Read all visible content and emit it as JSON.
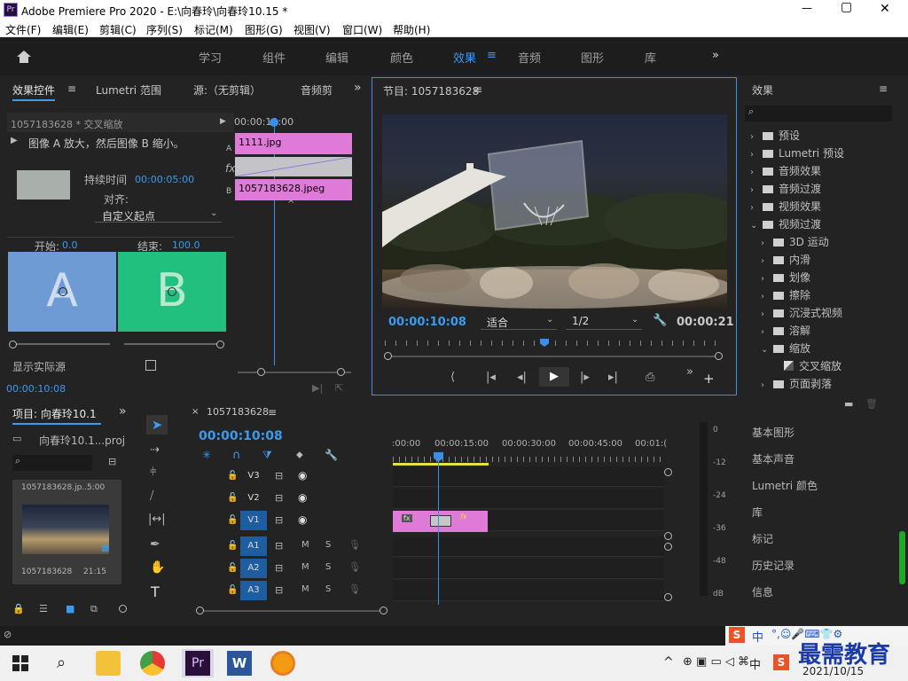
{
  "title": "Adobe Premiere Pro 2020 - E:\\向春玲\\向春玲10.15 *",
  "app_icon_label": "Pr",
  "window_controls": {
    "min": "—",
    "max": "▢",
    "close": "✕"
  },
  "menu": [
    "文件(F)",
    "编辑(E)",
    "剪辑(C)",
    "序列(S)",
    "标记(M)",
    "图形(G)",
    "视图(V)",
    "窗口(W)",
    "帮助(H)"
  ],
  "workspaces": [
    "学习",
    "组件",
    "编辑",
    "颜色",
    "效果",
    "音频",
    "图形",
    "库"
  ],
  "active_workspace": "效果",
  "effect_controls": {
    "tabs": [
      "效果控件",
      "Lumetri 范围",
      "源:（无剪辑）",
      "音频剪"
    ],
    "clip_name": "1057183628 * 交叉缩放",
    "description": "图像 A 放大，然后图像 B 缩小。",
    "duration_label": "持续时间",
    "duration_value": "00:00:05:00",
    "align_label": "对齐:",
    "align_value": "自定义起点",
    "start_label": "开始:",
    "start_value": "0.0",
    "end_label": "结束:",
    "end_value": "100.0",
    "a": "A",
    "b": "B",
    "show_actual": "显示实际源",
    "timecode": "00:00:10:08",
    "mini_timecode": "00:00:10:00",
    "clip_a": "1111.jpg",
    "clip_b": "1057183628.jpeg",
    "track_a": "A",
    "track_fx": "fx",
    "track_b": "B"
  },
  "program": {
    "title": "节目: 1057183628",
    "timecode": "00:00:10:08",
    "fit": "适合",
    "resolution": "1/2",
    "duration": "00:00:21"
  },
  "effects": {
    "title": "效果",
    "items": [
      {
        "label": "预设",
        "indent": 0,
        "open": false
      },
      {
        "label": "Lumetri 预设",
        "indent": 0,
        "open": false
      },
      {
        "label": "音频效果",
        "indent": 0,
        "open": false
      },
      {
        "label": "音频过渡",
        "indent": 0,
        "open": false
      },
      {
        "label": "视频效果",
        "indent": 0,
        "open": false
      },
      {
        "label": "视频过渡",
        "indent": 0,
        "open": true
      },
      {
        "label": "3D 运动",
        "indent": 1,
        "open": false
      },
      {
        "label": "内滑",
        "indent": 1,
        "open": false
      },
      {
        "label": "划像",
        "indent": 1,
        "open": false
      },
      {
        "label": "擦除",
        "indent": 1,
        "open": false
      },
      {
        "label": "沉浸式视频",
        "indent": 1,
        "open": false
      },
      {
        "label": "溶解",
        "indent": 1,
        "open": false
      },
      {
        "label": "缩放",
        "indent": 1,
        "open": true
      },
      {
        "label": "交叉缩放",
        "indent": 2,
        "open": false
      },
      {
        "label": "页面剥落",
        "indent": 1,
        "open": false
      }
    ],
    "side_panels": [
      "基本图形",
      "基本声音",
      "Lumetri 颜色",
      "库",
      "标记",
      "历史记录",
      "信息"
    ]
  },
  "project": {
    "title": "项目: 向春玲10.1",
    "file": "向春玲10.1...proj",
    "item_name": "1057183628.jp...",
    "item_dur": "5:00",
    "thumb_name": "1057183628",
    "thumb_dur": "21:15"
  },
  "timeline": {
    "seq_name": "1057183628",
    "timecode": "00:00:10:08",
    "ruler": [
      ":00:00",
      "00:00:15:00",
      "00:00:30:00",
      "00:00:45:00",
      "00:01:("
    ],
    "video_tracks": [
      "V3",
      "V2",
      "V1"
    ],
    "audio_tracks": [
      "A1",
      "A2",
      "A3"
    ],
    "m": "M",
    "s": "S"
  },
  "meter": [
    "0",
    "-12",
    "-24",
    "-36",
    "-48",
    "dB"
  ],
  "taskbar": {
    "date": "2021/10/15",
    "watermark": "最需教育",
    "ime": "中",
    "ime_brand": "S"
  }
}
